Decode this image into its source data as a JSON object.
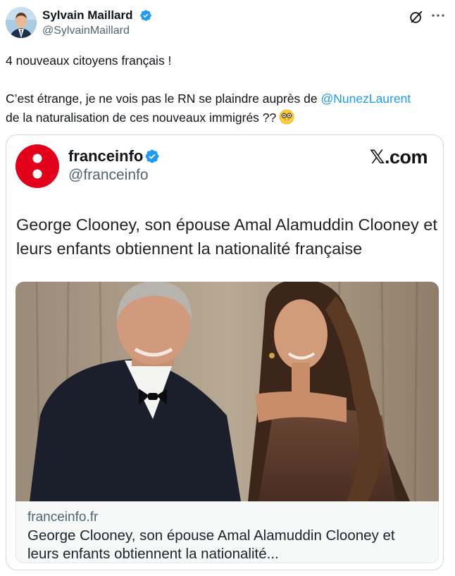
{
  "author": {
    "name": "Sylvain Maillard",
    "handle": "@SylvainMaillard"
  },
  "tweet": {
    "line1": "4 nouveaux citoyens français !",
    "line2_before": "C’est étrange, je ne vois pas le RN se plaindre auprès de ",
    "mention": "@NunezLaurent",
    "line3": "de la naturalisation de ces nouveaux immigrés ??"
  },
  "quote": {
    "name": "franceinfo",
    "handle": "@franceinfo",
    "source": "𝕏.com",
    "headline": "George Clooney, son épouse Amal Alamuddin Clooney et leurs enfants obtiennent la nationalité française",
    "link_domain": "franceinfo.fr",
    "link_title_1": "George Clooney, son épouse Amal Alamuddin Clooney et",
    "link_title_2": "leurs enfants obtiennent la nationalité..."
  },
  "icons": {
    "verified": "verified-badge-icon",
    "grok": "grok-icon",
    "more": "more-icon",
    "emoji": "nerd-face-emoji"
  },
  "colors": {
    "link": "#1d9bf0",
    "verified": "#1d9bf0",
    "franceinfo_red": "#e2001a"
  }
}
